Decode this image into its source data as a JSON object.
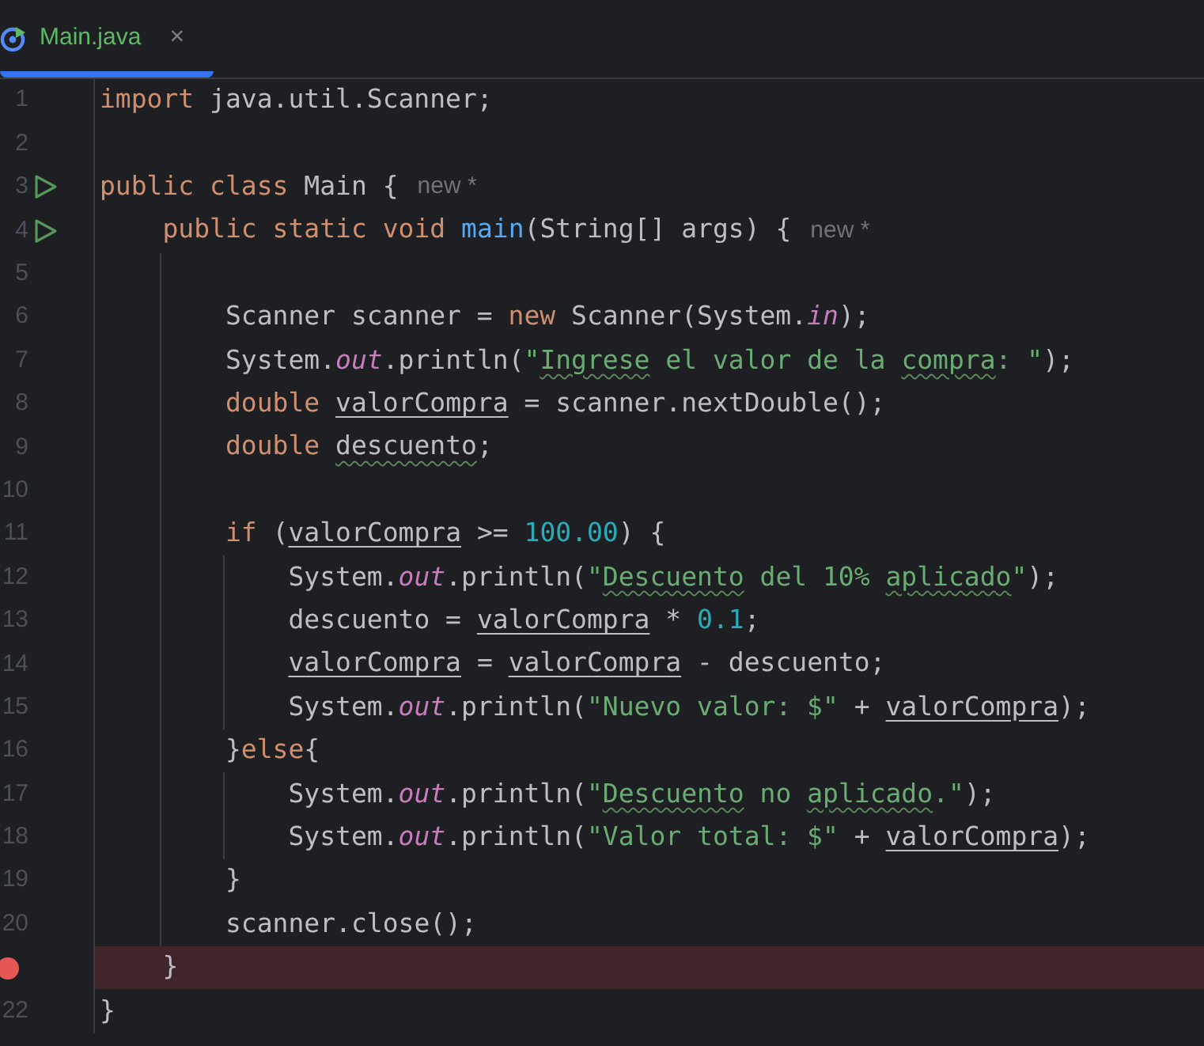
{
  "tab": {
    "title": "Main.java",
    "selected": true,
    "close": "×"
  },
  "lines": [
    {
      "number": "1",
      "breakpoint": false,
      "run": false,
      "highlighted": false,
      "tokens": [
        {
          "text": "import",
          "kind": "keyword"
        },
        {
          "text": " java.util.Scanner;",
          "kind": "plain"
        }
      ]
    },
    {
      "number": "2",
      "breakpoint": false,
      "run": false,
      "highlighted": false
    },
    {
      "number": "3",
      "breakpoint": false,
      "run": true,
      "highlighted": false,
      "tokens": [
        {
          "text": "public ",
          "kind": "keyword"
        },
        {
          "text": "class",
          "kind": "keyword"
        },
        {
          "text": " Main {",
          "kind": "plain"
        }
      ],
      "hint": "new *"
    },
    {
      "number": "4",
      "breakpoint": false,
      "run": true,
      "highlighted": false,
      "tokens": [
        {
          "text": "    public ",
          "kind": "keyword"
        },
        {
          "text": "static ",
          "kind": "keyword"
        },
        {
          "text": "void ",
          "kind": "keyword"
        },
        {
          "text": "main",
          "kind": "method"
        },
        {
          "text": "(String[] args) {",
          "kind": "plain"
        }
      ],
      "hint": "new *"
    },
    {
      "number": "5",
      "breakpoint": false,
      "run": false,
      "highlighted": false
    },
    {
      "number": "6",
      "breakpoint": false,
      "run": false,
      "highlighted": false,
      "tokens": [
        {
          "text": "        Scanner scanner = ",
          "kind": "plain"
        },
        {
          "text": "new",
          "kind": "keyword"
        },
        {
          "text": " Scanner(System.",
          "kind": "plain"
        },
        {
          "text": "in",
          "kind": "field"
        },
        {
          "text": ");",
          "kind": "plain"
        }
      ]
    },
    {
      "number": "7",
      "breakpoint": false,
      "run": false,
      "highlighted": false,
      "tokens": [
        {
          "text": "        System.",
          "kind": "plain"
        },
        {
          "text": "out",
          "kind": "field"
        },
        {
          "text": ".println(",
          "kind": "plain"
        },
        {
          "text": "\"",
          "kind": "string"
        },
        {
          "text": "Ingrese",
          "kind": "string",
          "typo": true
        },
        {
          "text": " el valor de la ",
          "kind": "string"
        },
        {
          "text": "compra",
          "kind": "string",
          "typo": true
        },
        {
          "text": ": \"",
          "kind": "string"
        },
        {
          "text": ");",
          "kind": "plain"
        }
      ]
    },
    {
      "number": "8",
      "breakpoint": false,
      "run": false,
      "highlighted": false,
      "tokens": [
        {
          "text": "        double ",
          "kind": "keyword"
        },
        {
          "text": "valorCompra",
          "kind": "variable"
        },
        {
          "text": " = scanner.nextDouble();",
          "kind": "plain"
        }
      ]
    },
    {
      "number": "9",
      "breakpoint": false,
      "run": false,
      "highlighted": false,
      "tokens": [
        {
          "text": "        double ",
          "kind": "keyword"
        },
        {
          "text": "descuento",
          "kind": "plain",
          "typo": true
        },
        {
          "text": ";",
          "kind": "plain"
        }
      ]
    },
    {
      "number": "10",
      "breakpoint": false,
      "run": false,
      "highlighted": false
    },
    {
      "number": "11",
      "breakpoint": false,
      "run": false,
      "highlighted": false,
      "tokens": [
        {
          "text": "        if",
          "kind": "keyword"
        },
        {
          "text": " (",
          "kind": "plain"
        },
        {
          "text": "valorCompra",
          "kind": "variable"
        },
        {
          "text": " >= ",
          "kind": "plain"
        },
        {
          "text": "100.00",
          "kind": "number"
        },
        {
          "text": ") {",
          "kind": "plain"
        }
      ]
    },
    {
      "number": "12",
      "breakpoint": false,
      "run": false,
      "highlighted": false,
      "tokens": [
        {
          "text": "            System.",
          "kind": "plain"
        },
        {
          "text": "out",
          "kind": "field"
        },
        {
          "text": ".println(",
          "kind": "plain"
        },
        {
          "text": "\"",
          "kind": "string"
        },
        {
          "text": "Descuento",
          "kind": "string",
          "typo": true
        },
        {
          "text": " del 10% ",
          "kind": "string"
        },
        {
          "text": "aplicado",
          "kind": "string",
          "typo": true
        },
        {
          "text": "\"",
          "kind": "string"
        },
        {
          "text": ");",
          "kind": "plain"
        }
      ]
    },
    {
      "number": "13",
      "breakpoint": false,
      "run": false,
      "highlighted": false,
      "tokens": [
        {
          "text": "            descuento = ",
          "kind": "plain"
        },
        {
          "text": "valorCompra",
          "kind": "variable"
        },
        {
          "text": " * ",
          "kind": "plain"
        },
        {
          "text": "0.1",
          "kind": "number"
        },
        {
          "text": ";",
          "kind": "plain"
        }
      ]
    },
    {
      "number": "14",
      "breakpoint": false,
      "run": false,
      "highlighted": false,
      "tokens": [
        {
          "text": "            valorCompra",
          "kind": "variable"
        },
        {
          "text": " = ",
          "kind": "plain"
        },
        {
          "text": "valorCompra",
          "kind": "variable"
        },
        {
          "text": " - descuento;",
          "kind": "plain"
        }
      ]
    },
    {
      "number": "15",
      "breakpoint": false,
      "run": false,
      "highlighted": false,
      "tokens": [
        {
          "text": "            System.",
          "kind": "plain"
        },
        {
          "text": "out",
          "kind": "field"
        },
        {
          "text": ".println(",
          "kind": "plain"
        },
        {
          "text": "\"Nuevo valor: $\"",
          "kind": "string"
        },
        {
          "text": " + ",
          "kind": "plain"
        },
        {
          "text": "valorCompra",
          "kind": "variable"
        },
        {
          "text": ");",
          "kind": "plain"
        }
      ]
    },
    {
      "number": "16",
      "breakpoint": false,
      "run": false,
      "highlighted": false,
      "tokens": [
        {
          "text": "        }",
          "kind": "plain"
        },
        {
          "text": "else",
          "kind": "keyword"
        },
        {
          "text": "{",
          "kind": "plain"
        }
      ]
    },
    {
      "number": "17",
      "breakpoint": false,
      "run": false,
      "highlighted": false,
      "tokens": [
        {
          "text": "            System.",
          "kind": "plain"
        },
        {
          "text": "out",
          "kind": "field"
        },
        {
          "text": ".println(",
          "kind": "plain"
        },
        {
          "text": "\"",
          "kind": "string"
        },
        {
          "text": "Descuento",
          "kind": "string",
          "typo": true
        },
        {
          "text": " no ",
          "kind": "string"
        },
        {
          "text": "aplicado",
          "kind": "string",
          "typo": true
        },
        {
          "text": ".\"",
          "kind": "string"
        },
        {
          "text": ");",
          "kind": "plain"
        }
      ]
    },
    {
      "number": "18",
      "breakpoint": false,
      "run": false,
      "highlighted": false,
      "tokens": [
        {
          "text": "            System.",
          "kind": "plain"
        },
        {
          "text": "out",
          "kind": "field"
        },
        {
          "text": ".println(",
          "kind": "plain"
        },
        {
          "text": "\"Valor total: $\"",
          "kind": "string"
        },
        {
          "text": " + ",
          "kind": "plain"
        },
        {
          "text": "valorCompra",
          "kind": "variable"
        },
        {
          "text": ");",
          "kind": "plain"
        }
      ]
    },
    {
      "number": "19",
      "breakpoint": false,
      "run": false,
      "highlighted": false,
      "tokens": [
        {
          "text": "        }",
          "kind": "plain"
        }
      ]
    },
    {
      "number": "20",
      "breakpoint": false,
      "run": false,
      "highlighted": false,
      "tokens": [
        {
          "text": "        scanner.close();",
          "kind": "plain"
        }
      ]
    },
    {
      "breakpoint": true,
      "run": false,
      "highlighted": true,
      "tokens": [
        {
          "text": "    }",
          "kind": "plain"
        }
      ]
    },
    {
      "number": "22",
      "breakpoint": false,
      "run": false,
      "highlighted": false,
      "tokens": [
        {
          "text": "}",
          "kind": "plain"
        }
      ]
    }
  ]
}
